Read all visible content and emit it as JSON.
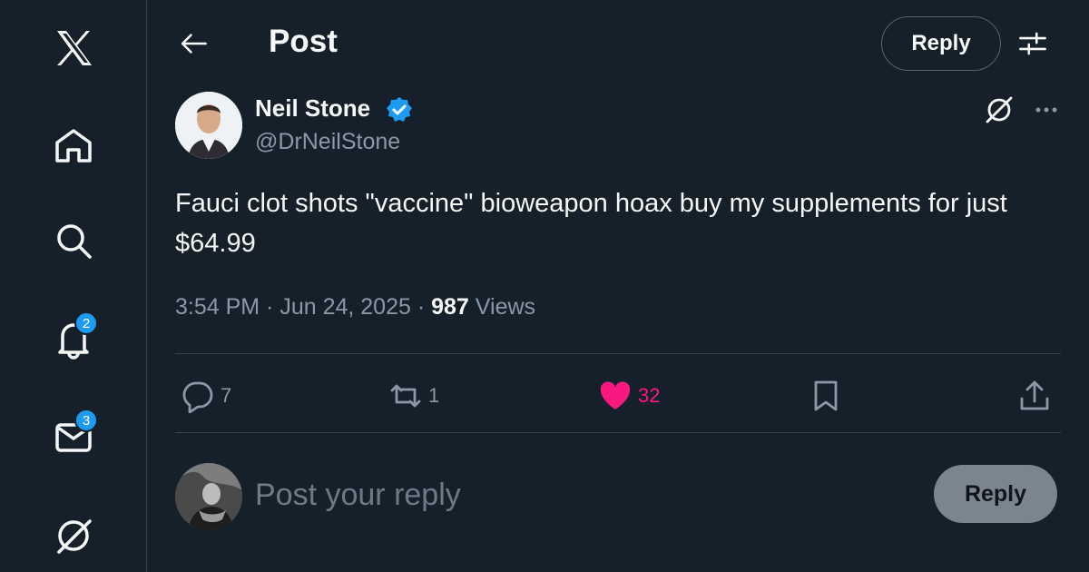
{
  "nav": {
    "notifications_badge": "2",
    "messages_badge": "3"
  },
  "header": {
    "title": "Post",
    "reply_label": "Reply"
  },
  "post": {
    "author_name": "Neil Stone",
    "handle": "@DrNeilStone",
    "text": "Fauci clot shots \"vaccine\" bioweapon hoax buy my supplements for just  $64.99",
    "time": "3:54 PM",
    "date": "Jun 24, 2025",
    "views_count": "987",
    "views_label": "Views",
    "replies": "7",
    "reposts": "1",
    "likes": "32"
  },
  "composer": {
    "placeholder": "Post your reply",
    "button_label": "Reply"
  },
  "colors": {
    "background": "#15202b",
    "accent": "#1d9bf0",
    "like": "#f91880",
    "muted_text": "#8b98a5",
    "divider": "#38444d"
  }
}
